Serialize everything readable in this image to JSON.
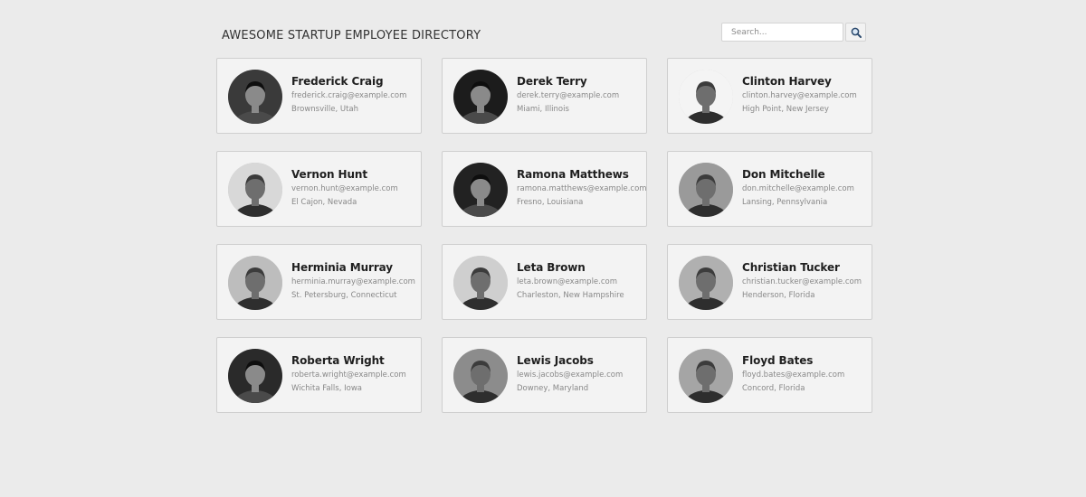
{
  "header": {
    "title": "AWESOME STARTUP EMPLOYEE DIRECTORY",
    "search_placeholder": "Search..."
  },
  "employees": [
    {
      "name": "Frederick Craig",
      "email": "frederick.craig@example.com",
      "location": "Brownsville, Utah",
      "avatar_tone": "#3a3a3a"
    },
    {
      "name": "Derek Terry",
      "email": "derek.terry@example.com",
      "location": "Miami, Illinois",
      "avatar_tone": "#1c1c1c"
    },
    {
      "name": "Clinton Harvey",
      "email": "clinton.harvey@example.com",
      "location": "High Point, New Jersey",
      "avatar_tone": "#f4f4f4"
    },
    {
      "name": "Vernon Hunt",
      "email": "vernon.hunt@example.com",
      "location": "El Cajon, Nevada",
      "avatar_tone": "#d8d8d8"
    },
    {
      "name": "Ramona Matthews",
      "email": "ramona.matthews@example.com",
      "location": "Fresno, Louisiana",
      "avatar_tone": "#222222"
    },
    {
      "name": "Don Mitchelle",
      "email": "don.mitchelle@example.com",
      "location": "Lansing, Pennsylvania",
      "avatar_tone": "#9a9a9a"
    },
    {
      "name": "Herminia Murray",
      "email": "herminia.murray@example.com",
      "location": "St. Petersburg, Connecticut",
      "avatar_tone": "#bdbdbd"
    },
    {
      "name": "Leta Brown",
      "email": "leta.brown@example.com",
      "location": "Charleston, New Hampshire",
      "avatar_tone": "#cfcfcf"
    },
    {
      "name": "Christian Tucker",
      "email": "christian.tucker@example.com",
      "location": "Henderson, Florida",
      "avatar_tone": "#b0b0b0"
    },
    {
      "name": "Roberta Wright",
      "email": "roberta.wright@example.com",
      "location": "Wichita Falls, Iowa",
      "avatar_tone": "#2a2a2a"
    },
    {
      "name": "Lewis Jacobs",
      "email": "lewis.jacobs@example.com",
      "location": "Downey, Maryland",
      "avatar_tone": "#8c8c8c"
    },
    {
      "name": "Floyd Bates",
      "email": "floyd.bates@example.com",
      "location": "Concord, Florida",
      "avatar_tone": "#a5a5a5"
    }
  ]
}
